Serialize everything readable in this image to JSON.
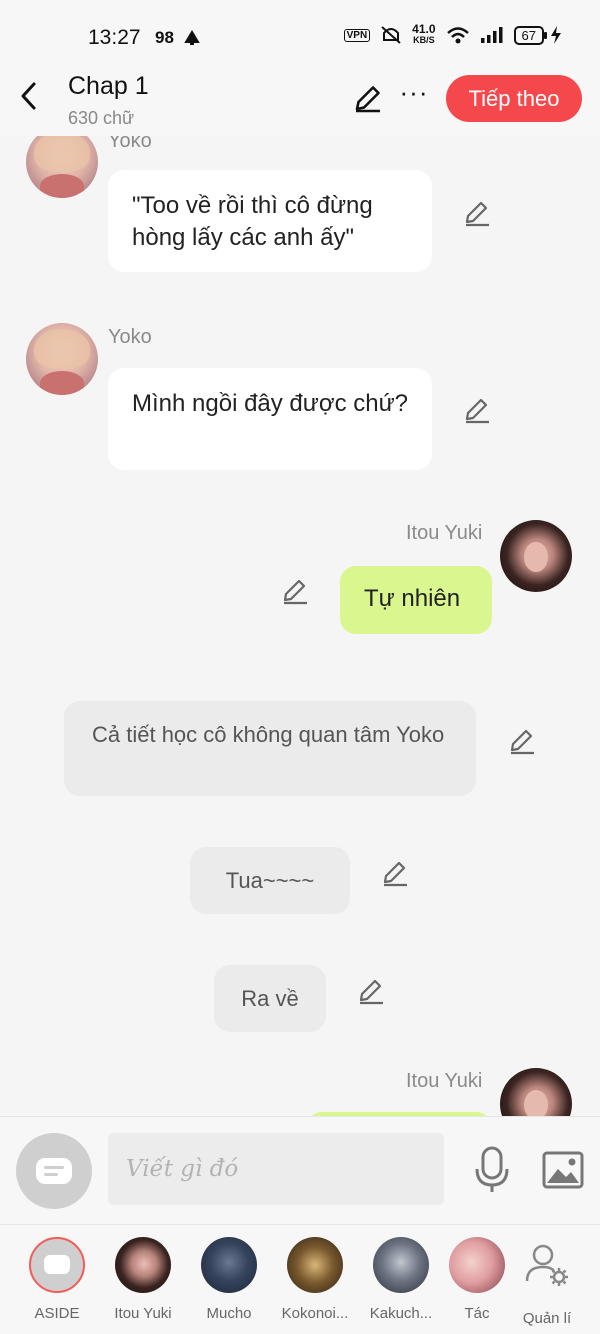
{
  "status_bar": {
    "time": "13:27",
    "notif_count": "98",
    "vpn": "VPN",
    "speed_value": "41.0",
    "speed_unit": "KB/S",
    "battery": "67"
  },
  "header": {
    "title": "Chap 1",
    "word_count": "630 chữ",
    "next_button": "Tiếp theo"
  },
  "messages": [
    {
      "sender": "Yoko",
      "text": "\"Too về rồi thì cô đừng hòng lấy các anh ấy\"",
      "side": "left"
    },
    {
      "sender": "Yoko",
      "text": "Mình ngồi đây được chứ?",
      "side": "left"
    },
    {
      "sender": "Itou Yuki",
      "text": "Tự nhiên",
      "side": "right"
    },
    {
      "sender": "",
      "text": "Cả tiết học cô không quan tâm Yoko",
      "side": "aside"
    },
    {
      "sender": "",
      "text": "Tua~~~~",
      "side": "aside"
    },
    {
      "sender": "",
      "text": "Ra về",
      "side": "aside"
    },
    {
      "sender": "Itou Yuki",
      "text": "",
      "side": "right"
    }
  ],
  "composer": {
    "placeholder": "Viết gì đó"
  },
  "characters": [
    {
      "label": "ASIDE"
    },
    {
      "label": "Itou Yuki"
    },
    {
      "label": "Mucho"
    },
    {
      "label": "Kokonoi..."
    },
    {
      "label": "Kakuch..."
    },
    {
      "label": "Tác"
    },
    {
      "label": "Quản lí"
    }
  ],
  "colors": {
    "accent": "#f5484d",
    "right_bubble": "#d9f68f",
    "background": "#f5f5f5"
  }
}
